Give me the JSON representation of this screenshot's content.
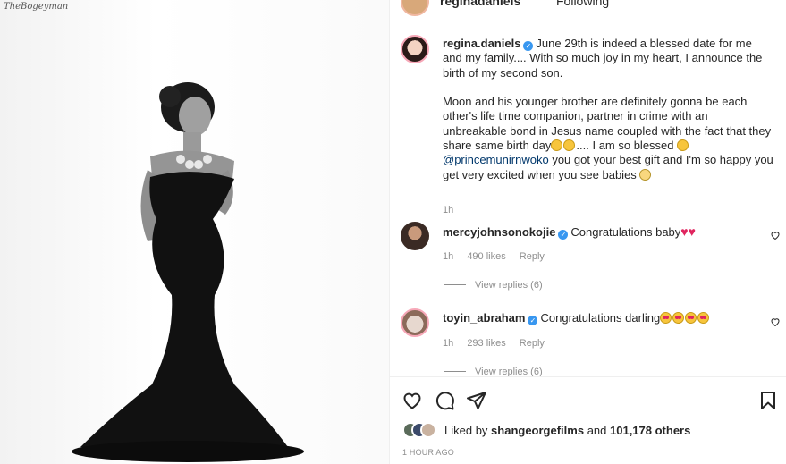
{
  "photo": {
    "watermark": "TheBogeyman"
  },
  "header": {
    "username": "reginadaniels",
    "follow_label": "Following"
  },
  "caption": {
    "username": "regina.daniels",
    "text1": "June 29th is indeed a blessed date for me and my family.... With so much joy in my heart, I announce the birth of my second son.",
    "text2a": "Moon and his younger brother are definitely gonna be each other's life time companion, partner in crime with an unbreakable bond in Jesus name coupled with the fact that they share same birth day",
    "text2b": ".... I am so blessed",
    "mention": "@princemunirnwoko",
    "text3": " you got your best gift and I'm so happy you get very excited when you see babies",
    "time": "1h"
  },
  "comments": [
    {
      "username": "mercyjohnsonokojie",
      "text": "Congratulations baby",
      "time": "1h",
      "likes": "490 likes",
      "reply": "Reply",
      "view_replies": "View replies (6)"
    },
    {
      "username": "toyin_abraham",
      "text": "Congratulations darling",
      "time": "1h",
      "likes": "293 likes",
      "reply": "Reply",
      "view_replies": "View replies (6)"
    }
  ],
  "likes": {
    "prefix": "Liked by ",
    "user": "shangeorgefilms",
    "middle": " and ",
    "count": "101,178 others"
  },
  "posted": "1 HOUR AGO",
  "icons": {
    "like": "heart-icon",
    "comment": "comment-icon",
    "share": "share-icon",
    "save": "bookmark-icon",
    "verified": "verified-badge-icon"
  },
  "colors": {
    "verified": "#3897f0",
    "link": "#00376b",
    "muted": "#8e8e8e",
    "heart_red": "#e0245e"
  }
}
